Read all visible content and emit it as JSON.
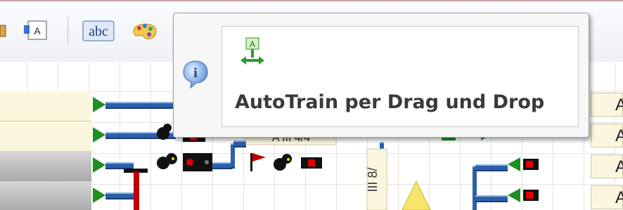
{
  "toolbar": {
    "items": [
      {
        "name": "drag-handle-icon",
        "label": ""
      },
      {
        "name": "text-field-icon",
        "label": "A"
      },
      {
        "name": "spellcheck-icon",
        "label": "abc"
      },
      {
        "name": "palette-icon",
        "label": ""
      }
    ]
  },
  "tooltip": {
    "info_icon": "i",
    "title": "AutoTrain per Drag und Drop",
    "autotrain_icon_letter": "A"
  },
  "track_panel": {
    "right_labels": [
      "A",
      "A",
      "A",
      "A"
    ],
    "vertical_label": "III 8/",
    "block_label": "A III 4/4"
  },
  "colors": {
    "tooltip_text": "#3a3a3a",
    "track_blue": "#2d5fa8",
    "signal_green": "#1f8f1f",
    "signal_red": "#e00000",
    "label_bg": "#fbf7df"
  }
}
